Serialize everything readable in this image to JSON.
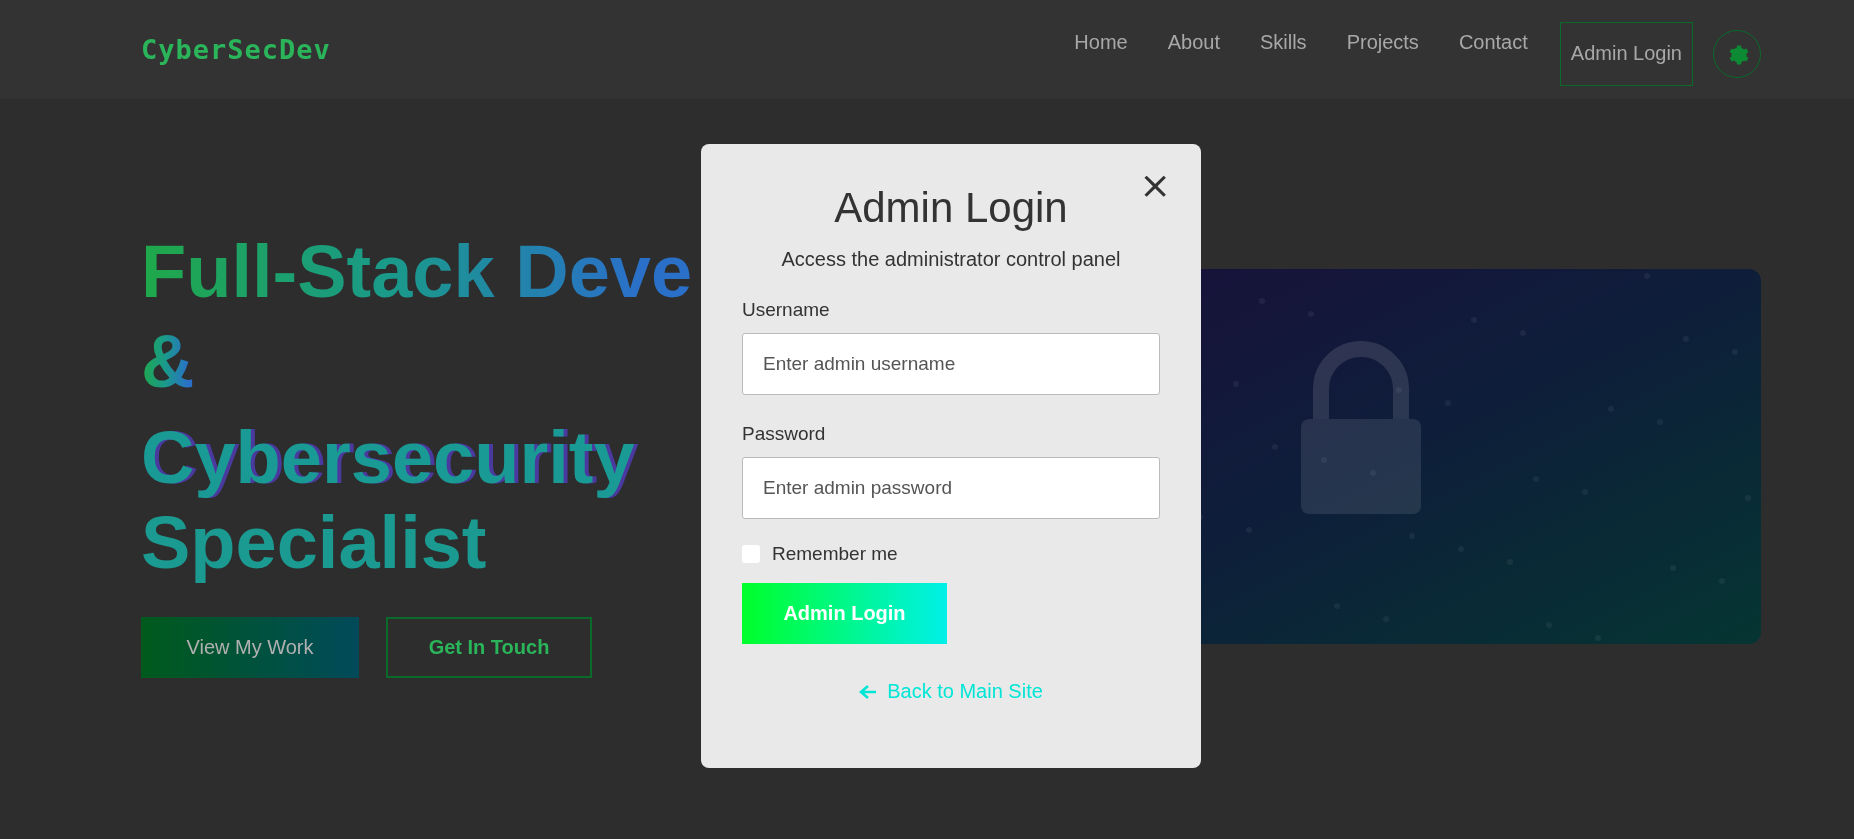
{
  "header": {
    "logo": "CyberSecDev",
    "nav": [
      {
        "label": "Home"
      },
      {
        "label": "About"
      },
      {
        "label": "Skills"
      },
      {
        "label": "Projects"
      },
      {
        "label": "Contact"
      }
    ],
    "admin_button": "Admin Login"
  },
  "hero": {
    "heading": [
      {
        "text": "Full-Stack Deve",
        "kind": "gradient"
      },
      {
        "text": "&",
        "kind": "gradient"
      },
      {
        "text": "Cybersecurity",
        "kind": "glitch"
      },
      {
        "text": "Specialist",
        "kind": "clipped"
      }
    ],
    "buttons": [
      {
        "label": "View My Work",
        "kind": "primary"
      },
      {
        "label": "Get In Touch",
        "kind": "outline"
      }
    ]
  },
  "modal": {
    "close": "×",
    "title": "Admin Login",
    "subtitle": "Access the administrator control panel",
    "fields": [
      {
        "label": "Username",
        "placeholder": "Enter admin username"
      },
      {
        "label": "Password",
        "placeholder": "Enter admin password"
      }
    ],
    "remember": {
      "label": "Remember me",
      "checked": false
    },
    "submit": "Admin Login",
    "back_link": "Back to Main Site"
  }
}
